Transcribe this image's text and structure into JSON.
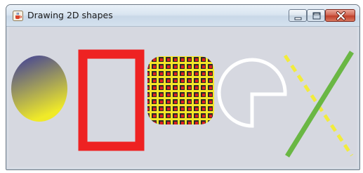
{
  "window": {
    "title": "Drawing 2D shapes"
  },
  "icons": {
    "app": "java-cup-icon",
    "minimize": "minimize-icon",
    "maximize": "maximize-icon",
    "close": "close-icon"
  },
  "colors": {
    "oval_gradient_start": "#3a3a9c",
    "oval_gradient_end": "#f0ea28",
    "rectangle_stroke": "#ee2222",
    "pattern_background": "#f5e628",
    "pattern_square": "#2a2a2a",
    "pattern_accent": "#dd2020",
    "arc_stroke": "#ffffff",
    "line_solid": "#6ab744",
    "line_dashed": "#f2ec3c"
  }
}
